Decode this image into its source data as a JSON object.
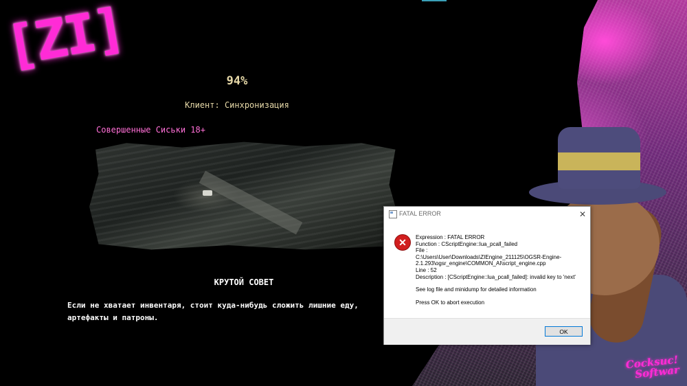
{
  "background": {
    "logo_text": "[ZI]",
    "progress_percent": "94%",
    "status_text": "Клиент: Синхронизация",
    "tip_header_pink": "Совершенные Сиськи 18+",
    "tip_title": "КРУТОЙ СОВЕТ",
    "tip_body": "Если не хватает инвентаря, стоит куда-нибудь сложить лишние еду, артефакты и патроны.",
    "watermark_line1": "Cocksuc!",
    "watermark_line2": "Softwar"
  },
  "dialog": {
    "title": "FATAL ERROR",
    "close_glyph": "✕",
    "error_glyph": "✕",
    "lines": {
      "expression": "Expression    : FATAL ERROR",
      "function": "Function      : CScriptEngine::lua_pcall_failed",
      "file_label": "File          :",
      "file_path": "C:\\Users\\User\\Downloads\\ZIEngine_211125\\OGSR-Engine-2.1.293\\ogsr_engine\\COMMON_AI\\script_engine.cpp",
      "line": "Line          : 52",
      "description": "Description   : [CScriptEngine::lua_pcall_failed]: invalid key to 'next'",
      "see_log": "See log file and minidump for detailed information",
      "press_ok": "Press OK to abort execution"
    },
    "ok_label": "OK"
  },
  "colors": {
    "accent_pink": "#ff2bd6",
    "loading_text": "#e7d9a8",
    "error_red": "#d11e1e",
    "button_focus": "#0078d7"
  }
}
